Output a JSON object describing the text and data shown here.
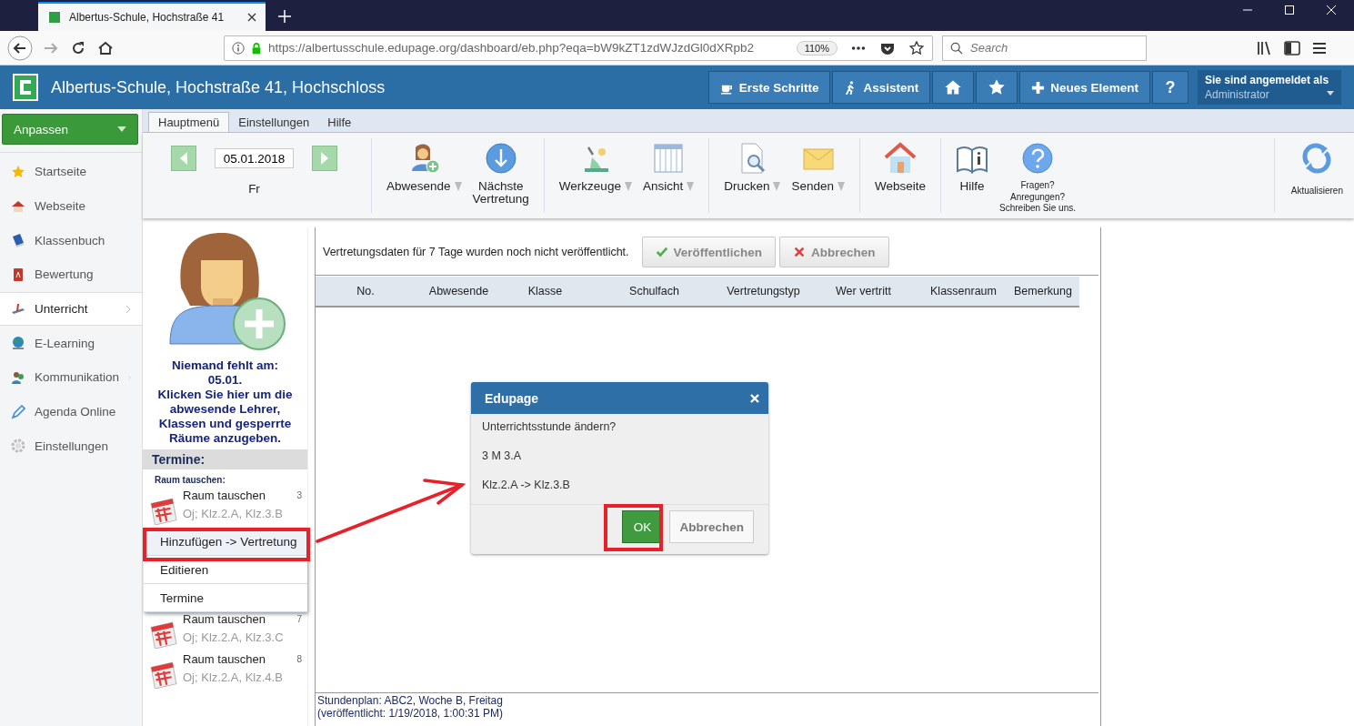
{
  "browser": {
    "tab_title": "Albertus-Schule, Hochstraße 41",
    "url": "https://albertusschule.edupage.org/dashboard/eb.php?eqa=bW9kZT1zdWJzdGl0dXRpb2",
    "zoom": "110%",
    "search_placeholder": "Search"
  },
  "app_header": {
    "title": "Albertus-Schule, Hochstraße 41, Hochschloss",
    "buttons": [
      {
        "kind": "cup",
        "label": "Erste Schritte"
      },
      {
        "kind": "walker",
        "label": "Assistent"
      },
      {
        "kind": "home"
      },
      {
        "kind": "star"
      },
      {
        "kind": "plus",
        "label": "Neues Element"
      },
      {
        "kind": "text",
        "label": "?"
      }
    ],
    "user": {
      "caption": "Sie sind angemeldet als",
      "name": "Administrator"
    }
  },
  "sidebar": {
    "customize_button": "Anpassen",
    "items": [
      {
        "kind": "star",
        "label": "Startseite",
        "selected": false,
        "submenu": false
      },
      {
        "kind": "house",
        "label": "Webseite",
        "selected": false,
        "submenu": false
      },
      {
        "kind": "book",
        "label": "Klassenbuch",
        "selected": false,
        "submenu": false
      },
      {
        "kind": "grade",
        "label": "Bewertung",
        "selected": false,
        "submenu": false
      },
      {
        "kind": "teach",
        "label": "Unterricht",
        "selected": true,
        "submenu": true
      },
      {
        "kind": "globe",
        "label": "E-Learning",
        "selected": false,
        "submenu": false
      },
      {
        "kind": "people",
        "label": "Kommunikation",
        "selected": false,
        "submenu": true
      },
      {
        "kind": "pen",
        "label": "Agenda Online",
        "selected": false,
        "submenu": false
      },
      {
        "kind": "gear",
        "label": "Einstellungen",
        "selected": false,
        "submenu": false
      }
    ]
  },
  "ribbon": {
    "tabs": [
      {
        "label": "Hauptmenü",
        "selected": true
      },
      {
        "label": "Einstellungen",
        "selected": false
      },
      {
        "label": "Hilfe",
        "selected": false
      }
    ],
    "date": "05.01.2018",
    "weekday": "Fr",
    "groups": [
      [
        {
          "kind": "absent",
          "label": "Abwesende",
          "dropdown": true
        },
        {
          "kind": "next",
          "label": "Nächste\nVertretung",
          "dropdown": false
        }
      ],
      [
        {
          "kind": "tools",
          "label": "Werkzeuge",
          "dropdown": true
        },
        {
          "kind": "view",
          "label": "Ansicht",
          "dropdown": true
        }
      ],
      [
        {
          "kind": "print",
          "label": "Drucken",
          "dropdown": true
        },
        {
          "kind": "send",
          "label": "Senden",
          "dropdown": true
        }
      ],
      [
        {
          "kind": "web",
          "label": "Webseite",
          "dropdown": false
        }
      ],
      [
        {
          "kind": "help",
          "label": "Hilfe",
          "dropdown": false
        },
        {
          "kind": "feedback",
          "label": "Fragen?\nAnregungen?\nSchreiben Sie uns.",
          "dropdown": false
        }
      ]
    ],
    "refresh": {
      "kind": "refresh",
      "label": "Aktualisieren"
    }
  },
  "absence_panel": {
    "message": "Niemand fehlt am:\n05.01.\nKlicken Sie hier um die\nabwesende Lehrer,\nKlassen und gesperrte\nRäume anzugeben.",
    "section_title": "Termine:",
    "group_title": "Raum tauschen:",
    "events": [
      {
        "title": "Raum tauschen",
        "detail": "Oj; Klz.2.A, Klz.3.B",
        "number": "3"
      },
      {
        "title": "Raum tauschen",
        "detail": "Oj; Klz.2.A, Klz.3.C",
        "number": "7"
      },
      {
        "title": "Raum tauschen",
        "detail": "Oj; Klz.2.A, Klz.4.B",
        "number": "8"
      }
    ]
  },
  "context_menu": {
    "items": [
      {
        "label": "Hinzufügen -> Vertretung",
        "selected": true
      },
      {
        "label": "Editieren",
        "selected": false
      },
      {
        "label": "Termine",
        "selected": false
      }
    ]
  },
  "main": {
    "notice": "Vertretungsdaten für 7 Tage wurden noch nicht veröffentlicht.",
    "publish_button": "Veröffentlichen",
    "cancel_button": "Abbrechen",
    "table": {
      "columns": [
        "No.",
        "Abwesende",
        "Klasse",
        "Schulfach",
        "Vertretungstyp",
        "Wer vertritt",
        "Klassenraum",
        "Bemerkung"
      ]
    },
    "footer": [
      "Stundenplan: ABC2, Woche B, Freitag",
      "(veröffentlicht: 1/19/2018, 1:00:31 PM)"
    ]
  },
  "dialog": {
    "title": "Edupage",
    "lines": [
      "Unterrichtsstunde ändern?",
      "3 M 3.A",
      "Klz.2.A -> Klz.3.B"
    ],
    "ok_button": "OK",
    "cancel_button": "Abbrechen"
  }
}
